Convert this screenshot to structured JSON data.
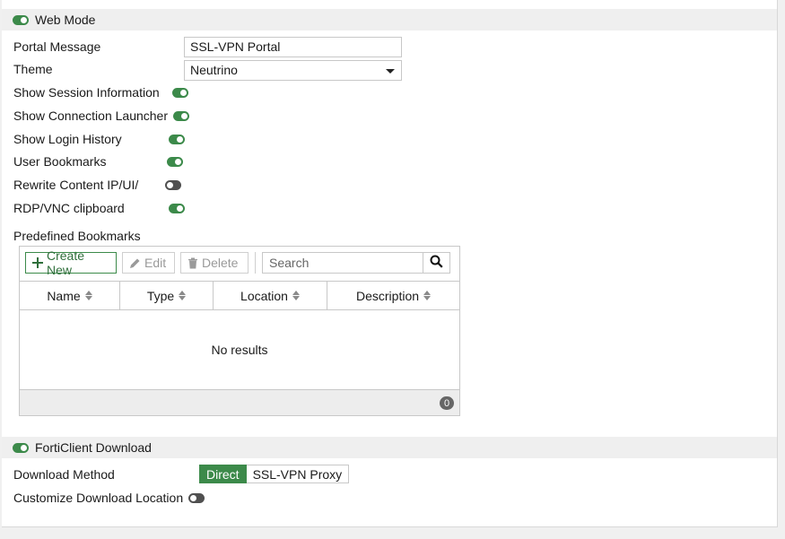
{
  "web_mode": {
    "label": "Web Mode",
    "enabled": true,
    "portal_message": {
      "label": "Portal Message",
      "value": "SSL-VPN Portal"
    },
    "theme": {
      "label": "Theme",
      "value": "Neutrino"
    },
    "toggles": [
      {
        "label": "Show Session Information",
        "on": true
      },
      {
        "label": "Show Connection Launcher",
        "on": true
      },
      {
        "label": "Show Login History",
        "on": true
      },
      {
        "label": "User Bookmarks",
        "on": true
      },
      {
        "label": "Rewrite Content IP/UI/",
        "on": false
      },
      {
        "label": "RDP/VNC clipboard",
        "on": true
      }
    ],
    "bookmarks": {
      "label": "Predefined Bookmarks",
      "toolbar": {
        "create": "Create New",
        "edit": "Edit",
        "delete": "Delete",
        "search_placeholder": "Search"
      },
      "columns": [
        "Name",
        "Type",
        "Location",
        "Description"
      ],
      "empty_text": "No results",
      "count": "0"
    }
  },
  "forticlient": {
    "label": "FortiClient Download",
    "enabled": true,
    "download_method": {
      "label": "Download Method",
      "options": [
        "Direct",
        "SSL-VPN Proxy"
      ],
      "selected": "Direct"
    },
    "custom_location": {
      "label": "Customize Download Location",
      "on": false
    }
  },
  "colors": {
    "accent": "#3c8a4a",
    "header_bg": "#efefef"
  }
}
